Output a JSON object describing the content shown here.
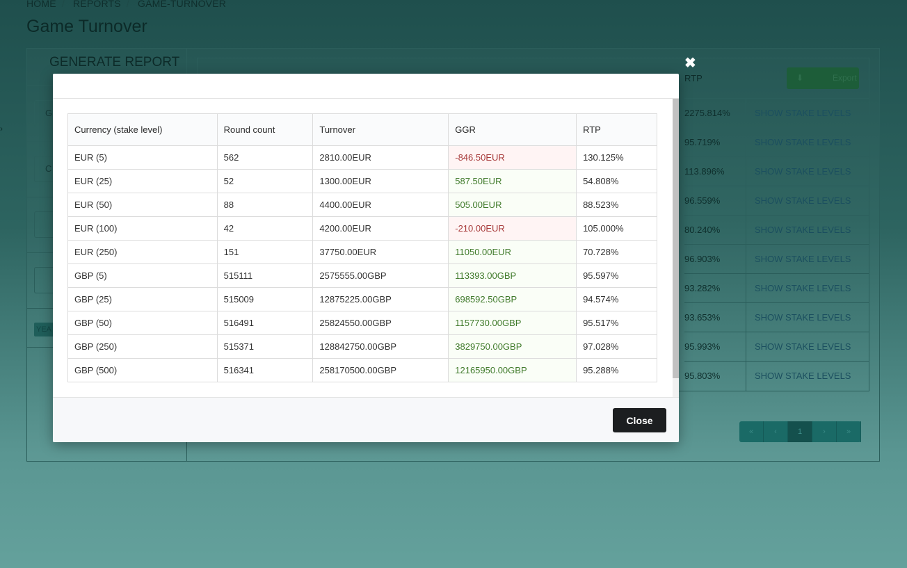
{
  "breadcrumb": [
    "HOME",
    "REPORTS",
    "GAME-TURNOVER"
  ],
  "page_title": "Game Turnover",
  "left_panel": {
    "title": "GENERATE REPORT",
    "boxes": [
      "G",
      "C",
      "",
      ""
    ],
    "badge": "YEA"
  },
  "bg_table": {
    "rtp_header": "RTP",
    "export_label": "Export",
    "link_label": "SHOW STAKE LEVELS",
    "rtp_values": [
      "2275.814%",
      "95.719%",
      "113.896%",
      "96.559%",
      "80.240%",
      "96.903%",
      "93.282%",
      "93.653%",
      "95.993%",
      "95.803%"
    ]
  },
  "pager": [
    "«",
    "‹",
    "1",
    "›",
    "»"
  ],
  "modal": {
    "close_icon": "✖",
    "close_button": "Close",
    "columns": [
      "Currency (stake level)",
      "Round count",
      "Turnover",
      "GGR",
      "RTP"
    ],
    "rows": [
      {
        "currency": "EUR (5)",
        "rounds": "562",
        "turnover": "2810.00EUR",
        "ggr": "-846.50EUR",
        "ggr_sign": "neg",
        "rtp": "130.125%"
      },
      {
        "currency": "EUR (25)",
        "rounds": "52",
        "turnover": "1300.00EUR",
        "ggr": "587.50EUR",
        "ggr_sign": "pos",
        "rtp": "54.808%"
      },
      {
        "currency": "EUR (50)",
        "rounds": "88",
        "turnover": "4400.00EUR",
        "ggr": "505.00EUR",
        "ggr_sign": "pos",
        "rtp": "88.523%"
      },
      {
        "currency": "EUR (100)",
        "rounds": "42",
        "turnover": "4200.00EUR",
        "ggr": "-210.00EUR",
        "ggr_sign": "neg",
        "rtp": "105.000%"
      },
      {
        "currency": "EUR (250)",
        "rounds": "151",
        "turnover": "37750.00EUR",
        "ggr": "11050.00EUR",
        "ggr_sign": "pos",
        "rtp": "70.728%"
      },
      {
        "currency": "GBP (5)",
        "rounds": "515111",
        "turnover": "2575555.00GBP",
        "ggr": "113393.00GBP",
        "ggr_sign": "pos",
        "rtp": "95.597%"
      },
      {
        "currency": "GBP (25)",
        "rounds": "515009",
        "turnover": "12875225.00GBP",
        "ggr": "698592.50GBP",
        "ggr_sign": "pos",
        "rtp": "94.574%"
      },
      {
        "currency": "GBP (50)",
        "rounds": "516491",
        "turnover": "25824550.00GBP",
        "ggr": "1157730.00GBP",
        "ggr_sign": "pos",
        "rtp": "95.517%"
      },
      {
        "currency": "GBP (250)",
        "rounds": "515371",
        "turnover": "128842750.00GBP",
        "ggr": "3829750.00GBP",
        "ggr_sign": "pos",
        "rtp": "97.028%"
      },
      {
        "currency": "GBP (500)",
        "rounds": "516341",
        "turnover": "258170500.00GBP",
        "ggr": "12165950.00GBP",
        "ggr_sign": "pos",
        "rtp": "95.288%"
      }
    ]
  },
  "colors": {
    "negative_text": "#a83a3a",
    "positive_text": "#3f7a2a",
    "close_button_bg": "#1c1e20",
    "backdrop": "#2d6460"
  }
}
